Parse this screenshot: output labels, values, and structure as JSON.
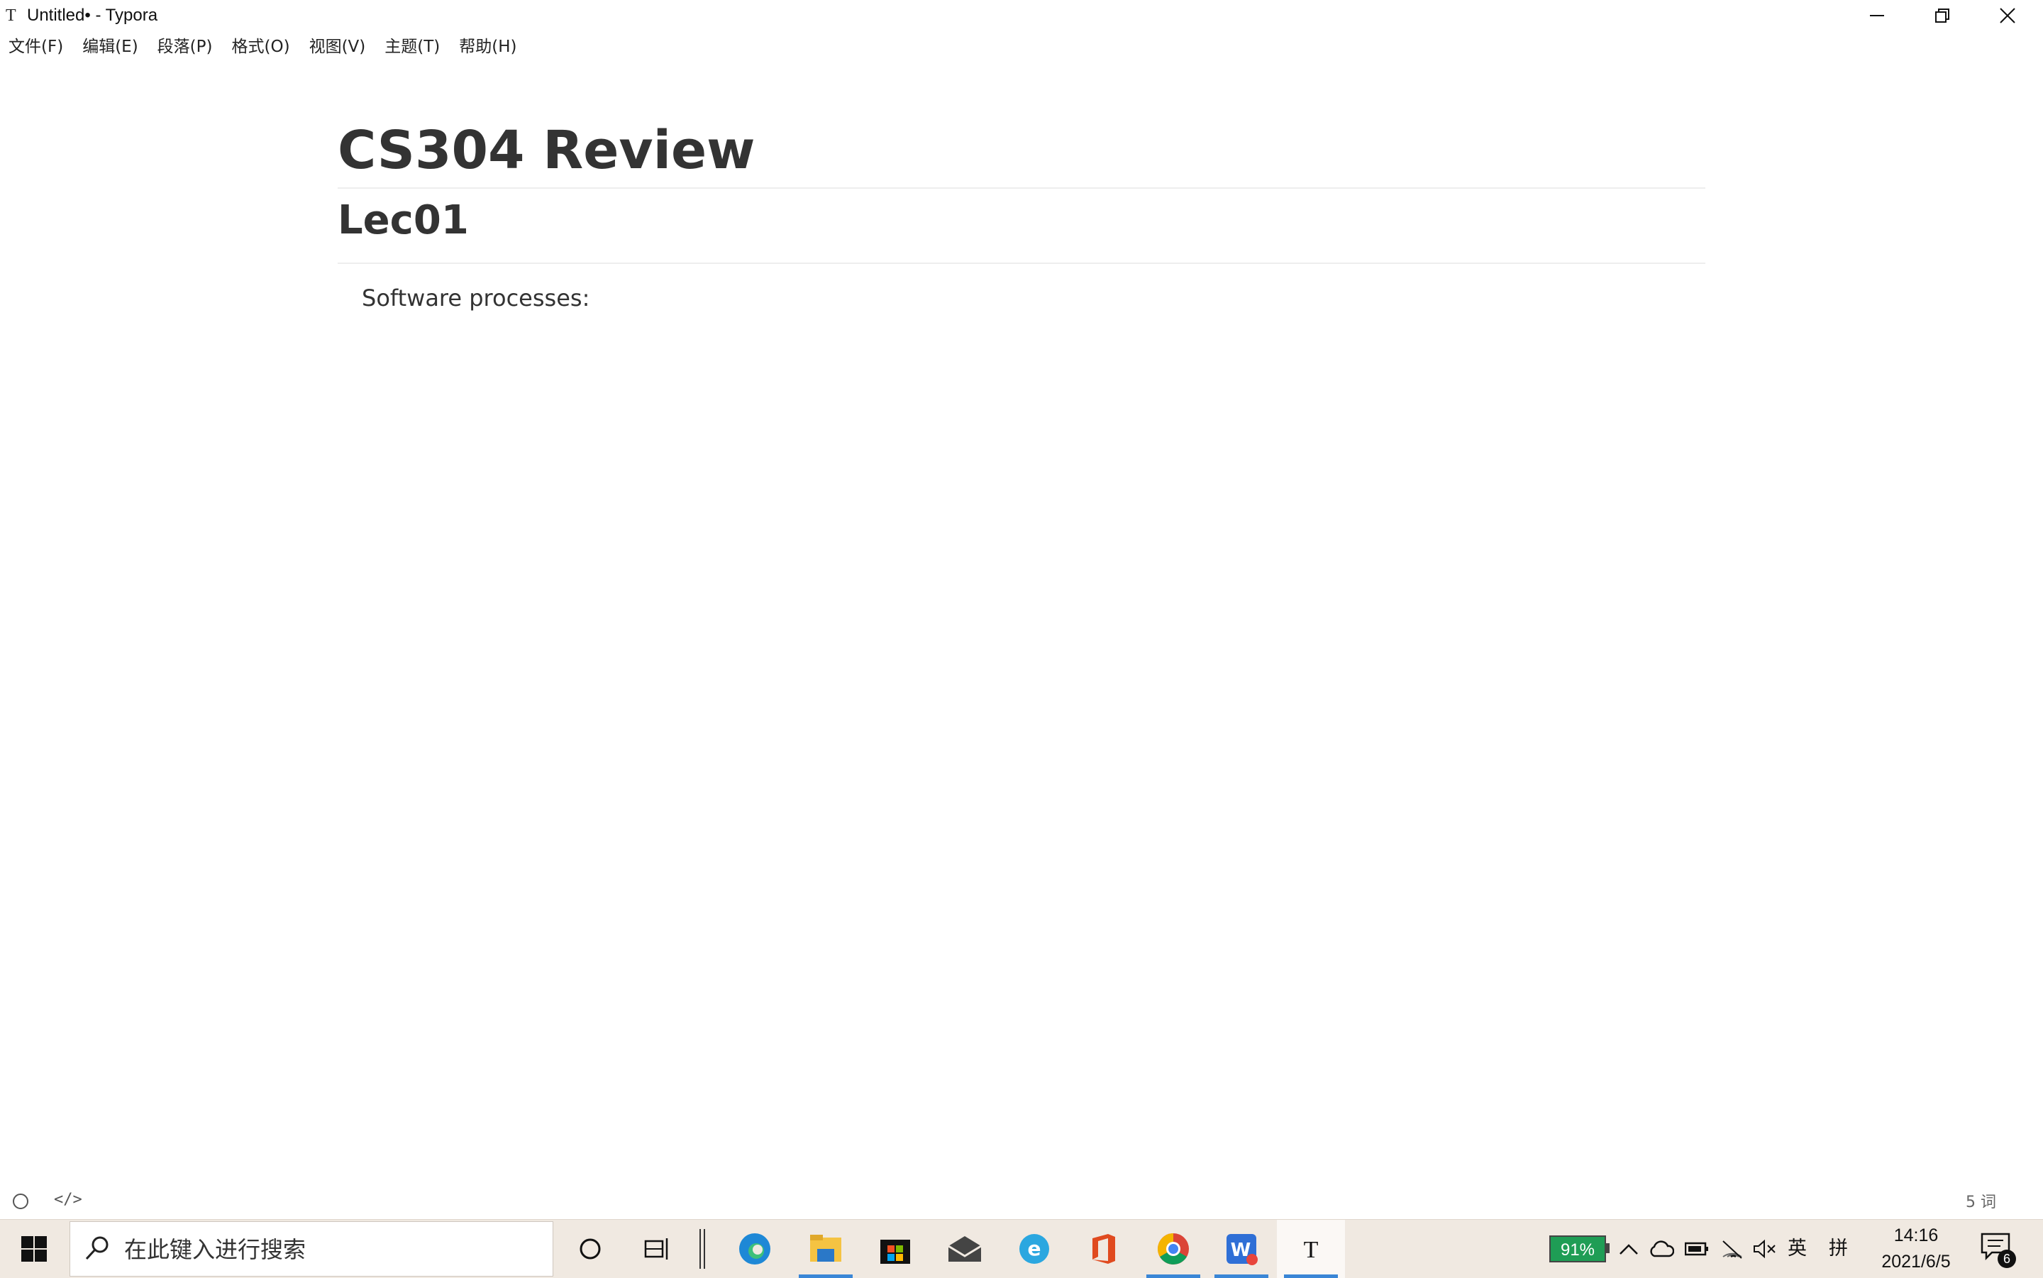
{
  "window": {
    "title": "Untitled• - Typora",
    "app_icon_glyph": "T"
  },
  "menu": {
    "items": [
      "文件(F)",
      "编辑(E)",
      "段落(P)",
      "格式(O)",
      "视图(V)",
      "主题(T)",
      "帮助(H)"
    ]
  },
  "document": {
    "h1": "CS304 Review",
    "h2": "Lec01",
    "paragraph": "Software processes:"
  },
  "footer": {
    "source_toggle": "</>",
    "word_count": "5 词"
  },
  "taskbar": {
    "search_placeholder": "在此键入进行搜索",
    "pinned_apps": [
      "cortana-icon",
      "task-view-icon",
      "edge-icon",
      "file-explorer-icon",
      "store-icon",
      "mail-icon",
      "ie-icon",
      "office-icon",
      "chrome-icon",
      "wps-icon",
      "typora-icon"
    ],
    "battery_percent": "91%",
    "ime_lang": "英",
    "ime_mode": "拼",
    "time": "14:16",
    "date": "2021/6/5",
    "notification_count": "6"
  },
  "colors": {
    "taskbar_bg": "#f0e9e1",
    "battery_green": "#1f9d55",
    "active_underline": "#3a86d6",
    "text": "#333333"
  }
}
